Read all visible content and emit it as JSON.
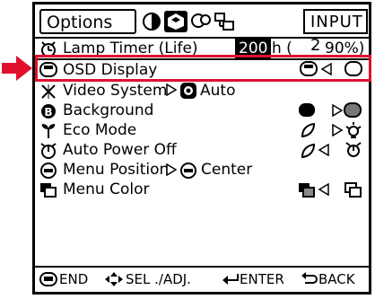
{
  "header": {
    "tab_label": "Options",
    "input_label": "INPUT 2"
  },
  "menu": {
    "items": [
      {
        "label": "Lamp Timer  (Life)",
        "icon": "lamp-timer-icon",
        "value_primary": "200",
        "value_unit": "h (",
        "value_secondary": "90%)"
      },
      {
        "label": "OSD Display",
        "icon": "osd-display-icon"
      },
      {
        "label": "Video System",
        "icon": "video-system-icon",
        "value": "Auto"
      },
      {
        "label": "Background",
        "icon": "background-icon"
      },
      {
        "label": "Eco Mode",
        "icon": "eco-mode-icon"
      },
      {
        "label": "Auto Power Off",
        "icon": "auto-power-off-icon"
      },
      {
        "label": "Menu Position",
        "icon": "menu-position-icon",
        "value": "Center"
      },
      {
        "label": "Menu Color",
        "icon": "menu-color-icon"
      }
    ]
  },
  "footer": {
    "end": "END",
    "sel": "SEL ./ADJ.",
    "enter": "ENTER",
    "back": "BACK"
  },
  "colors": {
    "highlight": "#e0102d",
    "text": "#000000",
    "background": "#ffffff"
  }
}
